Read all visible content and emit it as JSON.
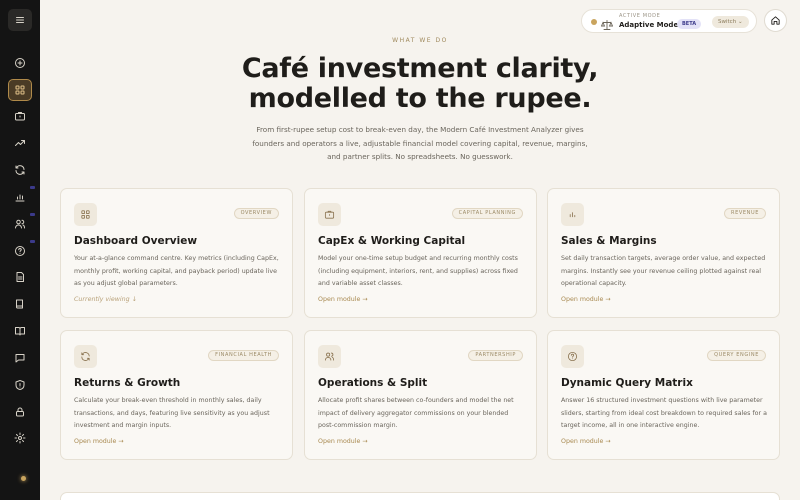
{
  "mode": {
    "label": "ACTIVE MODE",
    "name": "Adaptive Mode",
    "badge": "BETA",
    "switch_label": "Switch"
  },
  "hero": {
    "eyebrow": "WHAT WE DO",
    "headline_line1": "Café investment clarity,",
    "headline_line2": "modelled to the rupee.",
    "lede": "From first-rupee setup cost to break-even day, the Modern Café Investment Analyzer gives founders and operators a live, adjustable financial model covering capital, revenue, margins, and partner splits. No spreadsheets. No guesswork."
  },
  "cards": [
    {
      "icon": "grid-icon",
      "tag": "OVERVIEW",
      "title": "Dashboard Overview",
      "desc": "Your at-a-glance command centre. Key metrics (including CapEx, monthly profit, working capital, and payback period) update live as you adjust global parameters.",
      "link": "Currently viewing ↓"
    },
    {
      "icon": "briefcase-icon",
      "tag": "CAPITAL PLANNING",
      "title": "CapEx & Working Capital",
      "desc": "Model your one-time setup budget and recurring monthly costs (including equipment, interiors, rent, and supplies) across fixed and variable asset classes.",
      "link": "Open module →"
    },
    {
      "icon": "bar-chart-icon",
      "tag": "REVENUE",
      "title": "Sales & Margins",
      "desc": "Set daily transaction targets, average order value, and expected margins. Instantly see your revenue ceiling plotted against real operational capacity.",
      "link": "Open module →"
    },
    {
      "icon": "refresh-icon",
      "tag": "FINANCIAL HEALTH",
      "title": "Returns & Growth",
      "desc": "Calculate your break-even threshold in monthly sales, daily transactions, and days, featuring live sensitivity as you adjust investment and margin inputs.",
      "link": "Open module →"
    },
    {
      "icon": "users-icon",
      "tag": "PARTNERSHIP",
      "title": "Operations & Split",
      "desc": "Allocate profit shares between co-founders and model the net impact of delivery aggregator commissions on your blended post-commission margin.",
      "link": "Open module →"
    },
    {
      "icon": "help-icon",
      "tag": "QUERY ENGINE",
      "title": "Dynamic Query Matrix",
      "desc": "Answer 16 structured investment questions with live parameter sliders, starting from ideal cost breakdown to required sales for a target income, all in one interactive engine.",
      "link": "Open module →"
    }
  ],
  "sidebar_icons": [
    "menu-icon",
    "plus-circle-icon",
    "grid-icon",
    "briefcase-icon",
    "trend-up-icon",
    "refresh-icon",
    "bar-chart-icon",
    "users-icon",
    "help-icon",
    "document-icon",
    "book-icon",
    "open-book-icon",
    "chat-icon",
    "shield-icon",
    "lock-icon",
    "settings-icon"
  ]
}
